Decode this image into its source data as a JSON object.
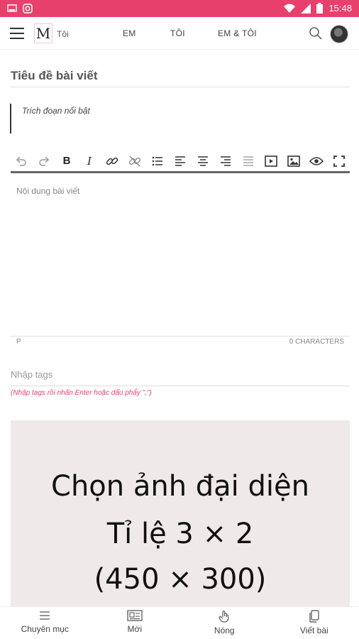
{
  "status_bar": {
    "time": "15:48",
    "background": "#e7406c"
  },
  "header": {
    "logo_letter": "M",
    "logo_text": "Tôi",
    "tabs": [
      "EM",
      "TÔI",
      "EM & TÔI"
    ]
  },
  "form": {
    "title_placeholder": "Tiêu đề bài viết",
    "excerpt_placeholder": "Trích đoạn nổi bật",
    "editor_placeholder": "Nội dung bài viết",
    "editor_element": "P",
    "char_count": "0 CHARACTERS",
    "tags_placeholder": "Nhập tags",
    "tags_hint": "(Nhập tags rồi nhấn Enter hoặc dấu phẩy \",\")",
    "toolbar": {
      "bold": "B",
      "italic": "I"
    }
  },
  "image_picker": {
    "line1": "Chọn ảnh đại diện",
    "line2": "Tỉ lệ 3 × 2",
    "line3": "(450 × 300)"
  },
  "bottom_nav": [
    {
      "label": "Chuyên mục",
      "icon": "list-icon"
    },
    {
      "label": "Mới",
      "icon": "news-icon"
    },
    {
      "label": "Nóng",
      "icon": "hand-icon"
    },
    {
      "label": "Viết bài",
      "icon": "document-icon"
    }
  ],
  "colors": {
    "accent": "#e7406c",
    "image_bg": "#efe9e9"
  }
}
